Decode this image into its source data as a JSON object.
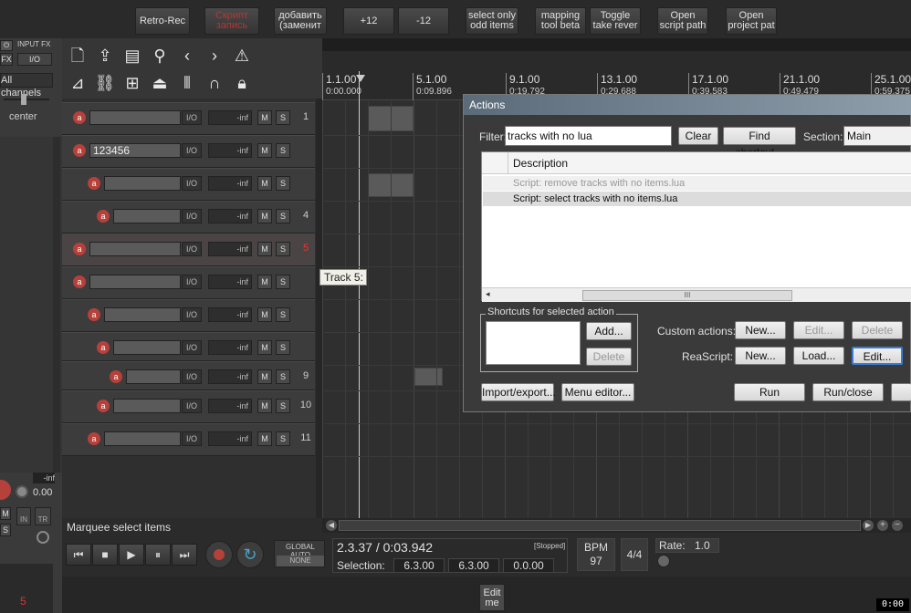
{
  "toolbar": {
    "buttons": [
      "Retro-Rec",
      "Скрипт\nзапись",
      "добавить\n(заменит",
      "+12",
      "-12",
      "select only\nodd items",
      "mapping\ntool beta",
      "Toggle\ntake rever",
      "Open\nscript path",
      "Open\nproject pat"
    ]
  },
  "leftpanel": {
    "input_fx": "INPUT FX",
    "fx": "FX",
    "io": "I/O",
    "channels": "All channels",
    "pan": "center",
    "vol_inf": "-inf",
    "vol_val": "0.00",
    "track5": "5",
    "m": "M",
    "s": "S",
    "in": "IN",
    "tr": "TR"
  },
  "tracks": [
    {
      "name": "",
      "num": "1",
      "vol": "-inf",
      "io": "I/O"
    },
    {
      "name": "123456",
      "num": "",
      "vol": "-inf",
      "io": "I/O"
    },
    {
      "name": "",
      "num": "",
      "vol": "-inf",
      "io": "I/O"
    },
    {
      "name": "",
      "num": "4",
      "vol": "-inf",
      "io": "I/O"
    },
    {
      "name": "",
      "num": "5",
      "vol": "-inf",
      "io": "I/O"
    },
    {
      "name": "",
      "num": "",
      "vol": "-inf",
      "io": "I/O"
    },
    {
      "name": "",
      "num": "",
      "vol": "-inf",
      "io": "I/O"
    },
    {
      "name": "",
      "num": "",
      "vol": "-inf",
      "io": "I/O"
    },
    {
      "name": "",
      "num": "9",
      "vol": "-inf",
      "io": "I/O"
    },
    {
      "name": "",
      "num": "10",
      "vol": "-inf",
      "io": "I/O"
    },
    {
      "name": "",
      "num": "11",
      "vol": "-inf",
      "io": "I/O"
    }
  ],
  "ms": {
    "m": "M",
    "s": "S"
  },
  "ruler": {
    "bars": [
      "1.1.00",
      "5.1.00",
      "9.1.00",
      "13.1.00",
      "17.1.00",
      "21.1.00",
      "25.1.00"
    ],
    "times": [
      "0:00.000",
      "0:09.896",
      "0:19.792",
      "0:29.688",
      "0:39.583",
      "0:49.479",
      "0:59.375"
    ]
  },
  "tooltip": "Track 5:",
  "actions": {
    "title": "Actions",
    "filter_label": "Filter:",
    "filter_value": "tracks with no lua",
    "clear": "Clear",
    "find_shortcut": "Find shortcut...",
    "section_label": "Section:",
    "section_value": "Main",
    "col_description": "Description",
    "rows": [
      "Script: remove tracks with no items.lua",
      "Script: select tracks with no items.lua"
    ],
    "scroll_mark": "III",
    "shortcuts_label": "Shortcuts for selected action",
    "add": "Add...",
    "delete": "Delete",
    "custom_label": "Custom actions:",
    "reascript_label": "ReaScript:",
    "new": "New...",
    "edit": "Edit...",
    "load": "Load...",
    "import_export": "Import/export...",
    "menu_editor": "Menu editor...",
    "run": "Run",
    "run_close": "Run/close"
  },
  "status": {
    "text": "Marquee select items"
  },
  "transport": {
    "global_auto": "GLOBAL AUTO",
    "none": "NONE",
    "position": "2.3.37 / 0:03.942",
    "stopped": "[Stopped]",
    "selection_label": "Selection:",
    "sel_start": "6.3.00",
    "sel_end": "6.3.00",
    "sel_len": "0.0.00",
    "bpm_label": "BPM",
    "bpm": "97",
    "timesig": "4/4",
    "rate_label": "Rate:",
    "rate": "1.0"
  },
  "bottom": {
    "edit_me": "Edit\nme",
    "clock": "0:00"
  }
}
